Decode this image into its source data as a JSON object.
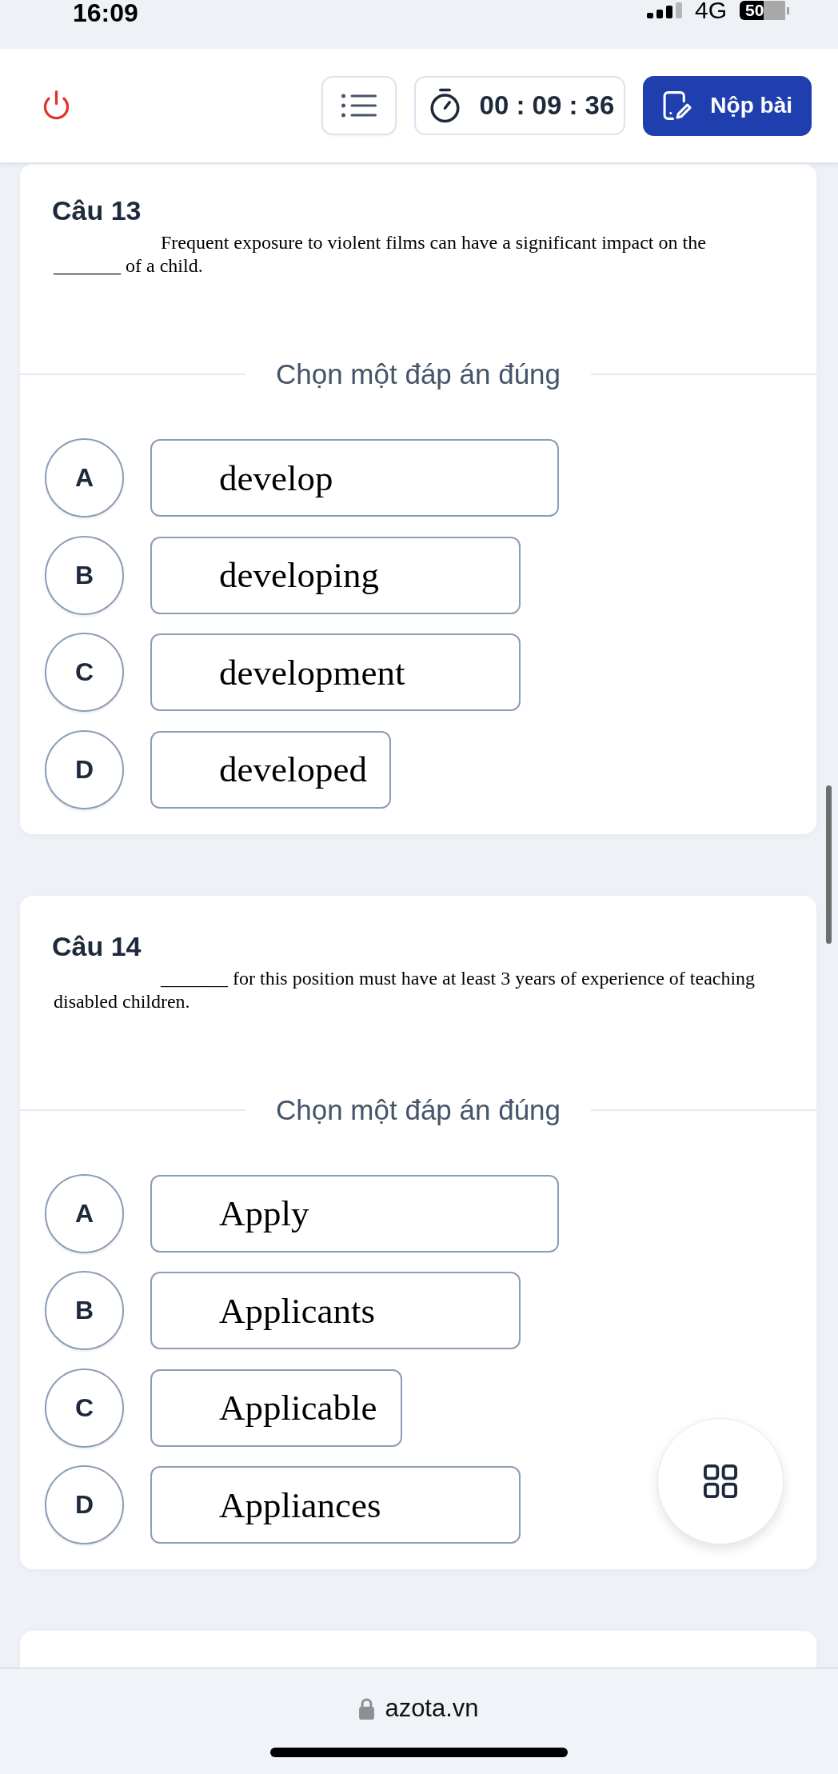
{
  "status_bar": {
    "time": "16:09",
    "network": "4G",
    "battery": "50"
  },
  "header": {
    "timer": "00 : 09 : 36",
    "submit_button": "Nộp bài"
  },
  "questions": [
    {
      "title": "Câu 13",
      "text": "Frequent exposure to violent films can have a significant impact on the _______ of a child.",
      "prompt": "Chọn một đáp án đúng",
      "options": [
        {
          "letter": "A",
          "text": "develop",
          "selected": false
        },
        {
          "letter": "B",
          "text": "developing",
          "selected": false
        },
        {
          "letter": "C",
          "text": "development",
          "selected": false
        },
        {
          "letter": "D",
          "text": "developed",
          "selected": false
        }
      ]
    },
    {
      "title": "Câu 14",
      "text": "_______ for this position must have at least 3 years of experience of teaching disabled children.",
      "prompt": "Chọn một đáp án đúng",
      "options": [
        {
          "letter": "A",
          "text": "Apply",
          "selected": false
        },
        {
          "letter": "B",
          "text": "Applicants",
          "selected": false
        },
        {
          "letter": "C",
          "text": "Applicable",
          "selected": false
        },
        {
          "letter": "D",
          "text": "Appliances",
          "selected": false
        }
      ]
    }
  ],
  "browser_bar": {
    "url": "azota.vn"
  }
}
